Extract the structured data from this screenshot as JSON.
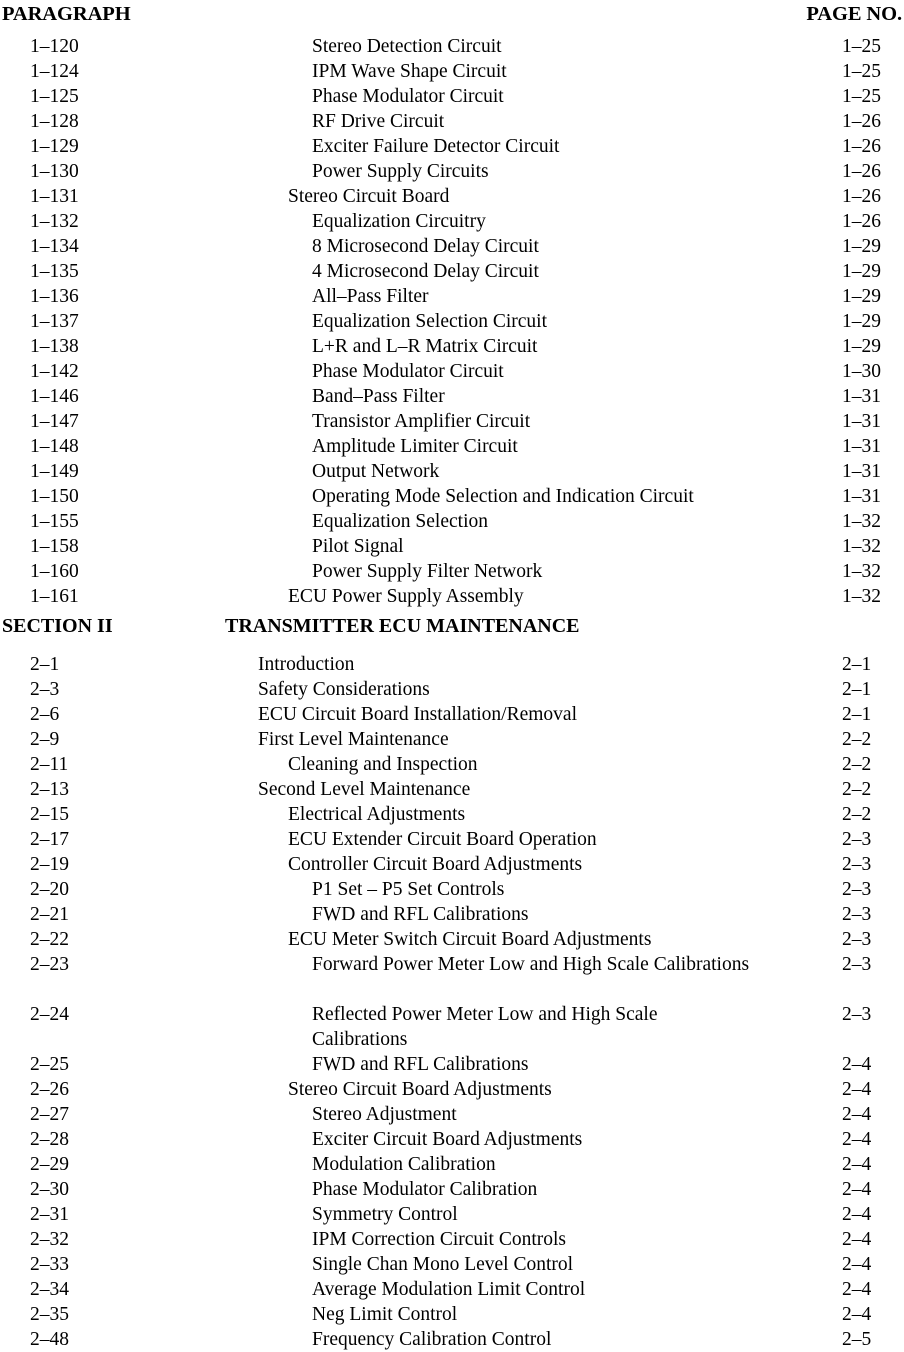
{
  "header": {
    "paragraph_label": "PARAGRAPH",
    "page_label": "PAGE NO."
  },
  "section_heading": {
    "label": "SECTION II",
    "title": "TRANSMITTER ECU MAINTENANCE"
  },
  "entries": [
    {
      "num": "1–120",
      "title": "Stereo Detection Circuit",
      "page": "1–25",
      "indent": 2
    },
    {
      "num": "1–124",
      "title": "IPM Wave Shape Circuit",
      "page": "1–25",
      "indent": 2
    },
    {
      "num": "1–125",
      "title": "Phase Modulator Circuit",
      "page": "1–25",
      "indent": 2
    },
    {
      "num": "1–128",
      "title": "RF Drive Circuit",
      "page": "1–26",
      "indent": 2
    },
    {
      "num": "1–129",
      "title": "Exciter Failure Detector Circuit",
      "page": "1–26",
      "indent": 2
    },
    {
      "num": "1–130",
      "title": "Power Supply Circuits",
      "page": "1–26",
      "indent": 2
    },
    {
      "num": "1–131",
      "title": "Stereo Circuit Board",
      "page": "1–26",
      "indent": 1
    },
    {
      "num": "1–132",
      "title": "Equalization Circuitry",
      "page": "1–26",
      "indent": 2
    },
    {
      "num": "1–134",
      "title": "8 Microsecond Delay Circuit",
      "page": "1–29",
      "indent": 2
    },
    {
      "num": "1–135",
      "title": "4 Microsecond Delay Circuit",
      "page": "1–29",
      "indent": 2
    },
    {
      "num": "1–136",
      "title": "All–Pass Filter",
      "page": "1–29",
      "indent": 2
    },
    {
      "num": "1–137",
      "title": "Equalization Selection Circuit",
      "page": "1–29",
      "indent": 2
    },
    {
      "num": "1–138",
      "title": "L+R and L–R Matrix Circuit",
      "page": "1–29",
      "indent": 2
    },
    {
      "num": "1–142",
      "title": "Phase Modulator Circuit",
      "page": "1–30",
      "indent": 2
    },
    {
      "num": "1–146",
      "title": "Band–Pass Filter",
      "page": "1–31",
      "indent": 2
    },
    {
      "num": "1–147",
      "title": "Transistor Amplifier Circuit",
      "page": "1–31",
      "indent": 2
    },
    {
      "num": "1–148",
      "title": "Amplitude Limiter Circuit",
      "page": "1–31",
      "indent": 2
    },
    {
      "num": "1–149",
      "title": "Output Network",
      "page": "1–31",
      "indent": 2
    },
    {
      "num": "1–150",
      "title": "Operating Mode Selection and Indication Circuit",
      "page": "1–31",
      "indent": 2
    },
    {
      "num": "1–155",
      "title": "Equalization Selection",
      "page": "1–32",
      "indent": 2
    },
    {
      "num": "1–158",
      "title": "Pilot Signal",
      "page": "1–32",
      "indent": 2
    },
    {
      "num": "1–160",
      "title": "Power Supply Filter Network",
      "page": "1–32",
      "indent": 2
    },
    {
      "num": "1–161",
      "title": "ECU Power Supply Assembly",
      "page": "1–32",
      "indent": 1
    }
  ],
  "entries_section2": [
    {
      "num": "2–1",
      "title": "Introduction",
      "page": "2–1",
      "indent": 0
    },
    {
      "num": "2–3",
      "title": "Safety Considerations",
      "page": "2–1",
      "indent": 0
    },
    {
      "num": "2–6",
      "title": "ECU Circuit Board Installation/Removal",
      "page": "2–1",
      "indent": 0
    },
    {
      "num": "2–9",
      "title": "First Level Maintenance",
      "page": "2–2",
      "indent": 0
    },
    {
      "num": "2–11",
      "title": "Cleaning and Inspection",
      "page": "2–2",
      "indent": 1
    },
    {
      "num": "2–13",
      "title": "Second Level Maintenance",
      "page": "2–2",
      "indent": 0
    },
    {
      "num": "2–15",
      "title": "Electrical Adjustments",
      "page": "2–2",
      "indent": 1
    },
    {
      "num": "2–17",
      "title": "ECU Extender Circuit Board Operation",
      "page": "2–3",
      "indent": 1
    },
    {
      "num": "2–19",
      "title": "Controller Circuit Board Adjustments",
      "page": "2–3",
      "indent": 1
    },
    {
      "num": "2–20",
      "title": "P1 Set – P5 Set Controls",
      "page": "2–3",
      "indent": 2
    },
    {
      "num": "2–21",
      "title": "FWD and RFL Calibrations",
      "page": "2–3",
      "indent": 2
    },
    {
      "num": "2–22",
      "title": "ECU Meter Switch Circuit Board Adjustments",
      "page": "2–3",
      "indent": 1
    },
    {
      "num": "2–23",
      "title": "Forward Power Meter Low and High Scale Calibrations",
      "page": "2–3",
      "indent": 2,
      "wrapped": true
    },
    {
      "num": "2–24",
      "title": "Reflected Power Meter Low and High Scale Calibrations",
      "page": "2–3",
      "indent": 2,
      "wrapped": true
    },
    {
      "num": "2–25",
      "title": "FWD and RFL Calibrations",
      "page": "2–4",
      "indent": 2
    },
    {
      "num": "2–26",
      "title": "Stereo Circuit Board Adjustments",
      "page": "2–4",
      "indent": 1
    },
    {
      "num": "2–27",
      "title": "Stereo Adjustment",
      "page": "2–4",
      "indent": 2
    },
    {
      "num": "2–28",
      "title": "Exciter Circuit Board Adjustments",
      "page": "2–4",
      "indent": 2
    },
    {
      "num": "2–29",
      "title": "Modulation Calibration",
      "page": "2–4",
      "indent": 2
    },
    {
      "num": "2–30",
      "title": "Phase Modulator Calibration",
      "page": "2–4",
      "indent": 2
    },
    {
      "num": "2–31",
      "title": "Symmetry Control",
      "page": "2–4",
      "indent": 2
    },
    {
      "num": "2–32",
      "title": "IPM Correction Circuit Controls",
      "page": "2–4",
      "indent": 2
    },
    {
      "num": "2–33",
      "title": "Single Chan Mono Level Control",
      "page": "2–4",
      "indent": 2
    },
    {
      "num": "2–34",
      "title": "Average Modulation Limit Control",
      "page": "2–4",
      "indent": 2
    },
    {
      "num": "2–35",
      "title": "Neg Limit Control",
      "page": "2–4",
      "indent": 2
    },
    {
      "num": "2–48",
      "title": "Frequency Calibration Control",
      "page": "2–5",
      "indent": 2
    }
  ]
}
